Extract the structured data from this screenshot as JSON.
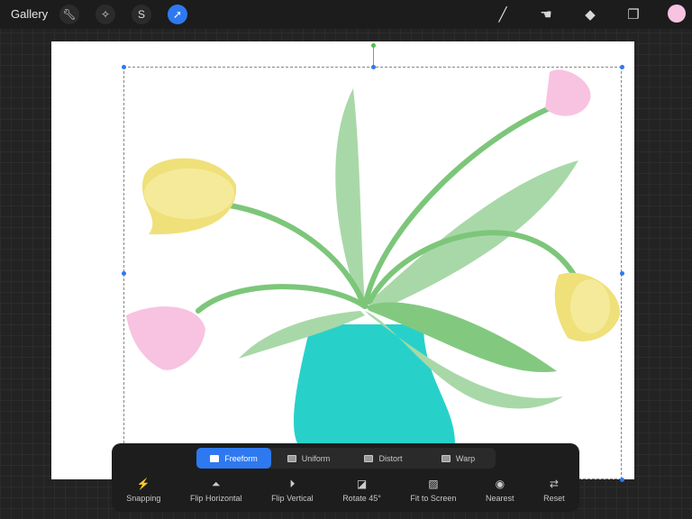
{
  "topbar": {
    "gallery": "Gallery",
    "left_tools": [
      "wrench-icon",
      "magic-wand-icon",
      "selection-icon",
      "transform-icon"
    ],
    "right_tools": [
      "brush-icon",
      "smudge-icon",
      "eraser-icon",
      "layers-icon"
    ],
    "current_color": "#f7c3e1"
  },
  "transform": {
    "modes": [
      {
        "label": "Freeform",
        "active": true
      },
      {
        "label": "Uniform",
        "active": false
      },
      {
        "label": "Distort",
        "active": false
      },
      {
        "label": "Warp",
        "active": false
      }
    ],
    "actions": [
      {
        "label": "Snapping",
        "icon": "⚡",
        "active": true
      },
      {
        "label": "Flip Horizontal",
        "icon": "⏶"
      },
      {
        "label": "Flip Vertical",
        "icon": "⏵"
      },
      {
        "label": "Rotate 45°",
        "icon": "◪"
      },
      {
        "label": "Fit to Screen",
        "icon": "▨"
      },
      {
        "label": "Nearest",
        "icon": "◉"
      },
      {
        "label": "Reset",
        "icon": "⇄"
      }
    ]
  },
  "colors": {
    "accent": "#2e79f0",
    "vase": "#27d1c9",
    "leaf": "#a8d8a8",
    "stem": "#7cc67a",
    "yellow": "#efe07a",
    "pink": "#f7c3e1"
  }
}
